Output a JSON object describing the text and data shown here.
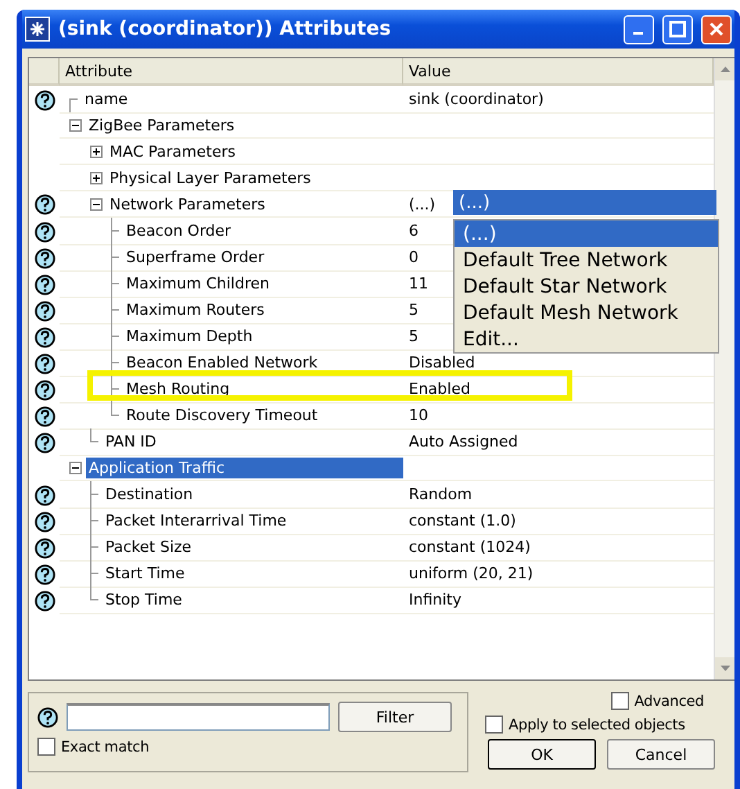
{
  "window": {
    "title": "(sink (coordinator)) Attributes"
  },
  "table": {
    "columns": [
      "Attribute",
      "Value"
    ],
    "rows": [
      {
        "name": "name",
        "value": "sink (coordinator)",
        "help": true,
        "selected": false
      },
      {
        "name": "ZigBee Parameters",
        "help": false,
        "selected": false,
        "expanded": true,
        "children": [
          {
            "name": "MAC Parameters",
            "help": false,
            "selected": false,
            "expanded": false
          },
          {
            "name": "Physical Layer Parameters",
            "help": false,
            "selected": false,
            "expanded": false
          },
          {
            "name": "Network Parameters",
            "value": "(...)",
            "help": true,
            "selected": false,
            "expanded": true,
            "dropdown": {
              "value": "(...)",
              "options": [
                {
                  "label": "(...)",
                  "selected": true
                },
                {
                  "label": "Default Tree Network",
                  "selected": false
                },
                {
                  "label": "Default Star Network",
                  "selected": false
                },
                {
                  "label": "Default Mesh Network",
                  "selected": false
                },
                {
                  "label": "Edit...",
                  "selected": false
                }
              ]
            },
            "children": [
              {
                "name": "Beacon Order",
                "value": "6",
                "help": true,
                "selected": false
              },
              {
                "name": "Superframe Order",
                "value": "0",
                "help": true,
                "selected": false
              },
              {
                "name": "Maximum Children",
                "value": "11",
                "help": true,
                "selected": false
              },
              {
                "name": "Maximum Routers",
                "value": "5",
                "help": true,
                "selected": false
              },
              {
                "name": "Maximum Depth",
                "value": "5",
                "help": true,
                "selected": false
              },
              {
                "name": "Beacon Enabled Network",
                "value": "Disabled",
                "help": true,
                "selected": false
              },
              {
                "name": "Mesh Routing",
                "value": "Enabled",
                "help": true,
                "selected": false,
                "highlighted": true
              },
              {
                "name": "Route Discovery Timeout",
                "value": "10",
                "help": true,
                "selected": false
              }
            ]
          },
          {
            "name": "PAN ID",
            "value": "Auto Assigned",
            "help": true,
            "selected": false
          }
        ]
      },
      {
        "name": "Application Traffic",
        "help": false,
        "selected": true,
        "expanded": true,
        "children": [
          {
            "name": "Destination",
            "value": "Random",
            "help": true,
            "selected": false
          },
          {
            "name": "Packet Interarrival Time",
            "value": "constant (1.0)",
            "help": true,
            "selected": false
          },
          {
            "name": "Packet Size",
            "value": "constant (1024)",
            "help": true,
            "selected": false
          },
          {
            "name": "Start Time",
            "value": "uniform (20, 21)",
            "help": true,
            "selected": false
          },
          {
            "name": "Stop Time",
            "value": "Infinity",
            "help": true,
            "selected": false
          }
        ]
      }
    ]
  },
  "filter": {
    "button": "Filter",
    "exact_match": {
      "label": "Exact match",
      "checked": false
    }
  },
  "advanced": {
    "label": "Advanced",
    "checked": false
  },
  "apply_to_selected": {
    "label": "Apply to selected objects",
    "checked": false
  },
  "buttons": [
    "OK",
    "Cancel"
  ]
}
